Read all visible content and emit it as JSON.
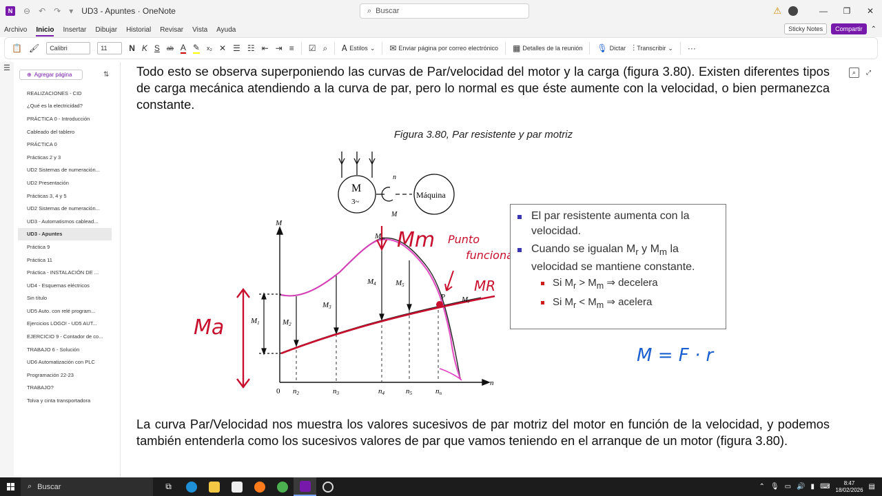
{
  "window": {
    "title": "UD3 - Apuntes · OneNote",
    "search_placeholder": "Buscar",
    "minimize": "—",
    "maximize": "❐",
    "close": "✕"
  },
  "menu": {
    "items": [
      "Archivo",
      "Inicio",
      "Insertar",
      "Dibujar",
      "Historial",
      "Revisar",
      "Vista",
      "Ayuda"
    ],
    "active": "Inicio",
    "sticky_notes": "Sticky Notes",
    "share": "Compartir"
  },
  "ribbon": {
    "font_name": "Calibri",
    "font_size": "11",
    "bold": "N",
    "italic": "K",
    "underline": "S",
    "strike": "ab",
    "styles": "Estilos",
    "email_page": "Enviar página por correo electrónico",
    "meeting_details": "Detalles de la reunión",
    "dictate": "Dictar",
    "transcribe": "Transcribir",
    "more": "···"
  },
  "sidebar": {
    "add_page": "Agregar página",
    "pages": [
      "REALIZACIONES - CID",
      "¿Qué es la electricidad?",
      "PRÁCTICA 0 - Introducción",
      "Cableado  del tablero",
      "PRÁCTICA  0",
      "Prácticas 2 y 3",
      "UD2 Sistemas de numeración...",
      "UD2 Presentación",
      "Prácticas 3, 4 y 5",
      "UD2 Sistemas de numeración...",
      "UD3 - Automatismos cablead...",
      "UD3 - Apuntes",
      "Práctica 9",
      "Práctica 11",
      "Práctica  - INSTALACIÓN DE ...",
      "UD4 -  Esquemas eléctricos",
      "Sin título",
      "UD5 Auto. con relé program...",
      "Ejercicios LOGO! - UD5 AUT...",
      "EJERCICIO 9 - Contador de co...",
      "TRABAJO 6 - Solución",
      "UD6 Automatización con PLC",
      "Programación 22-23",
      "TRABAJO?",
      "Tolva y cinta transportadora"
    ],
    "active_page": "UD3 - Apuntes"
  },
  "content": {
    "paragraph_top": "Todo esto se observa superponiendo las curvas de Par/velocidad del motor y la carga (figura 3.80). Existen diferentes tipos de carga mecánica atendiendo a la curva de par, pero lo normal es que éste aumente con la velocidad, o bien permanezca constante.",
    "caption": "Figura 3.80, Par resistente y par motriz",
    "paragraph_bottom": "La curva Par/Velocidad nos muestra los valores sucesivos de par motriz del motor en función de la velocidad, y podemos también entenderla como los sucesivos valores de par que vamos teniendo en el arranque de un motor (figura 3.80)."
  },
  "figure": {
    "motor_label": "M",
    "motor_phase": "3~",
    "machine_label": "Máquina",
    "speed_symbol": "n",
    "torque_symbol": "M",
    "y_axis_label": "M",
    "x_axis_label": "n",
    "origin": "0",
    "m_max_label": "M",
    "m_max_sub": "m",
    "point_label": "P",
    "mr_label": "M",
    "mr_sub": "r",
    "m_levels": [
      {
        "main": "M",
        "sub": "1"
      },
      {
        "main": "M",
        "sub": "2"
      },
      {
        "main": "M",
        "sub": "3"
      },
      {
        "main": "M",
        "sub": "4"
      },
      {
        "main": "M",
        "sub": "5"
      }
    ],
    "x_ticks": [
      {
        "main": "n",
        "sub": "2"
      },
      {
        "main": "n",
        "sub": "3"
      },
      {
        "main": "n",
        "sub": "4"
      },
      {
        "main": "n",
        "sub": "5"
      },
      {
        "main": "n",
        "sub": "n"
      }
    ],
    "handwriting": {
      "ma": "Ma",
      "mm": "Mm",
      "punto": "Punto",
      "funciona": "funciona.",
      "mr": "MR",
      "formula": "M = F · r"
    }
  },
  "infobox": {
    "bullet1": "El par resistente aumenta con la velocidad.",
    "bullet2_a": "Cuando se igualan M",
    "bullet2_sub1": "r",
    "bullet2_b": " y M",
    "bullet2_sub2": "m",
    "bullet2_c": " la velocidad se mantiene constante.",
    "sub1_a": "Si M",
    "sub1_sub1": "r",
    "sub1_b": " > M",
    "sub1_sub2": "m",
    "sub1_c": " ⇒ decelera",
    "sub2_a": "Si M",
    "sub2_sub1": "r",
    "sub2_b": " < M",
    "sub2_sub2": "m",
    "sub2_c": " ⇒ acelera"
  },
  "taskbar": {
    "search": "Buscar",
    "time": "8:47",
    "date": "18/02/2026"
  },
  "colors": {
    "accent": "#7719aa",
    "ink_red": "#c8102e",
    "ink_pink": "#e040c0",
    "ink_blue": "#1a5fd0"
  }
}
